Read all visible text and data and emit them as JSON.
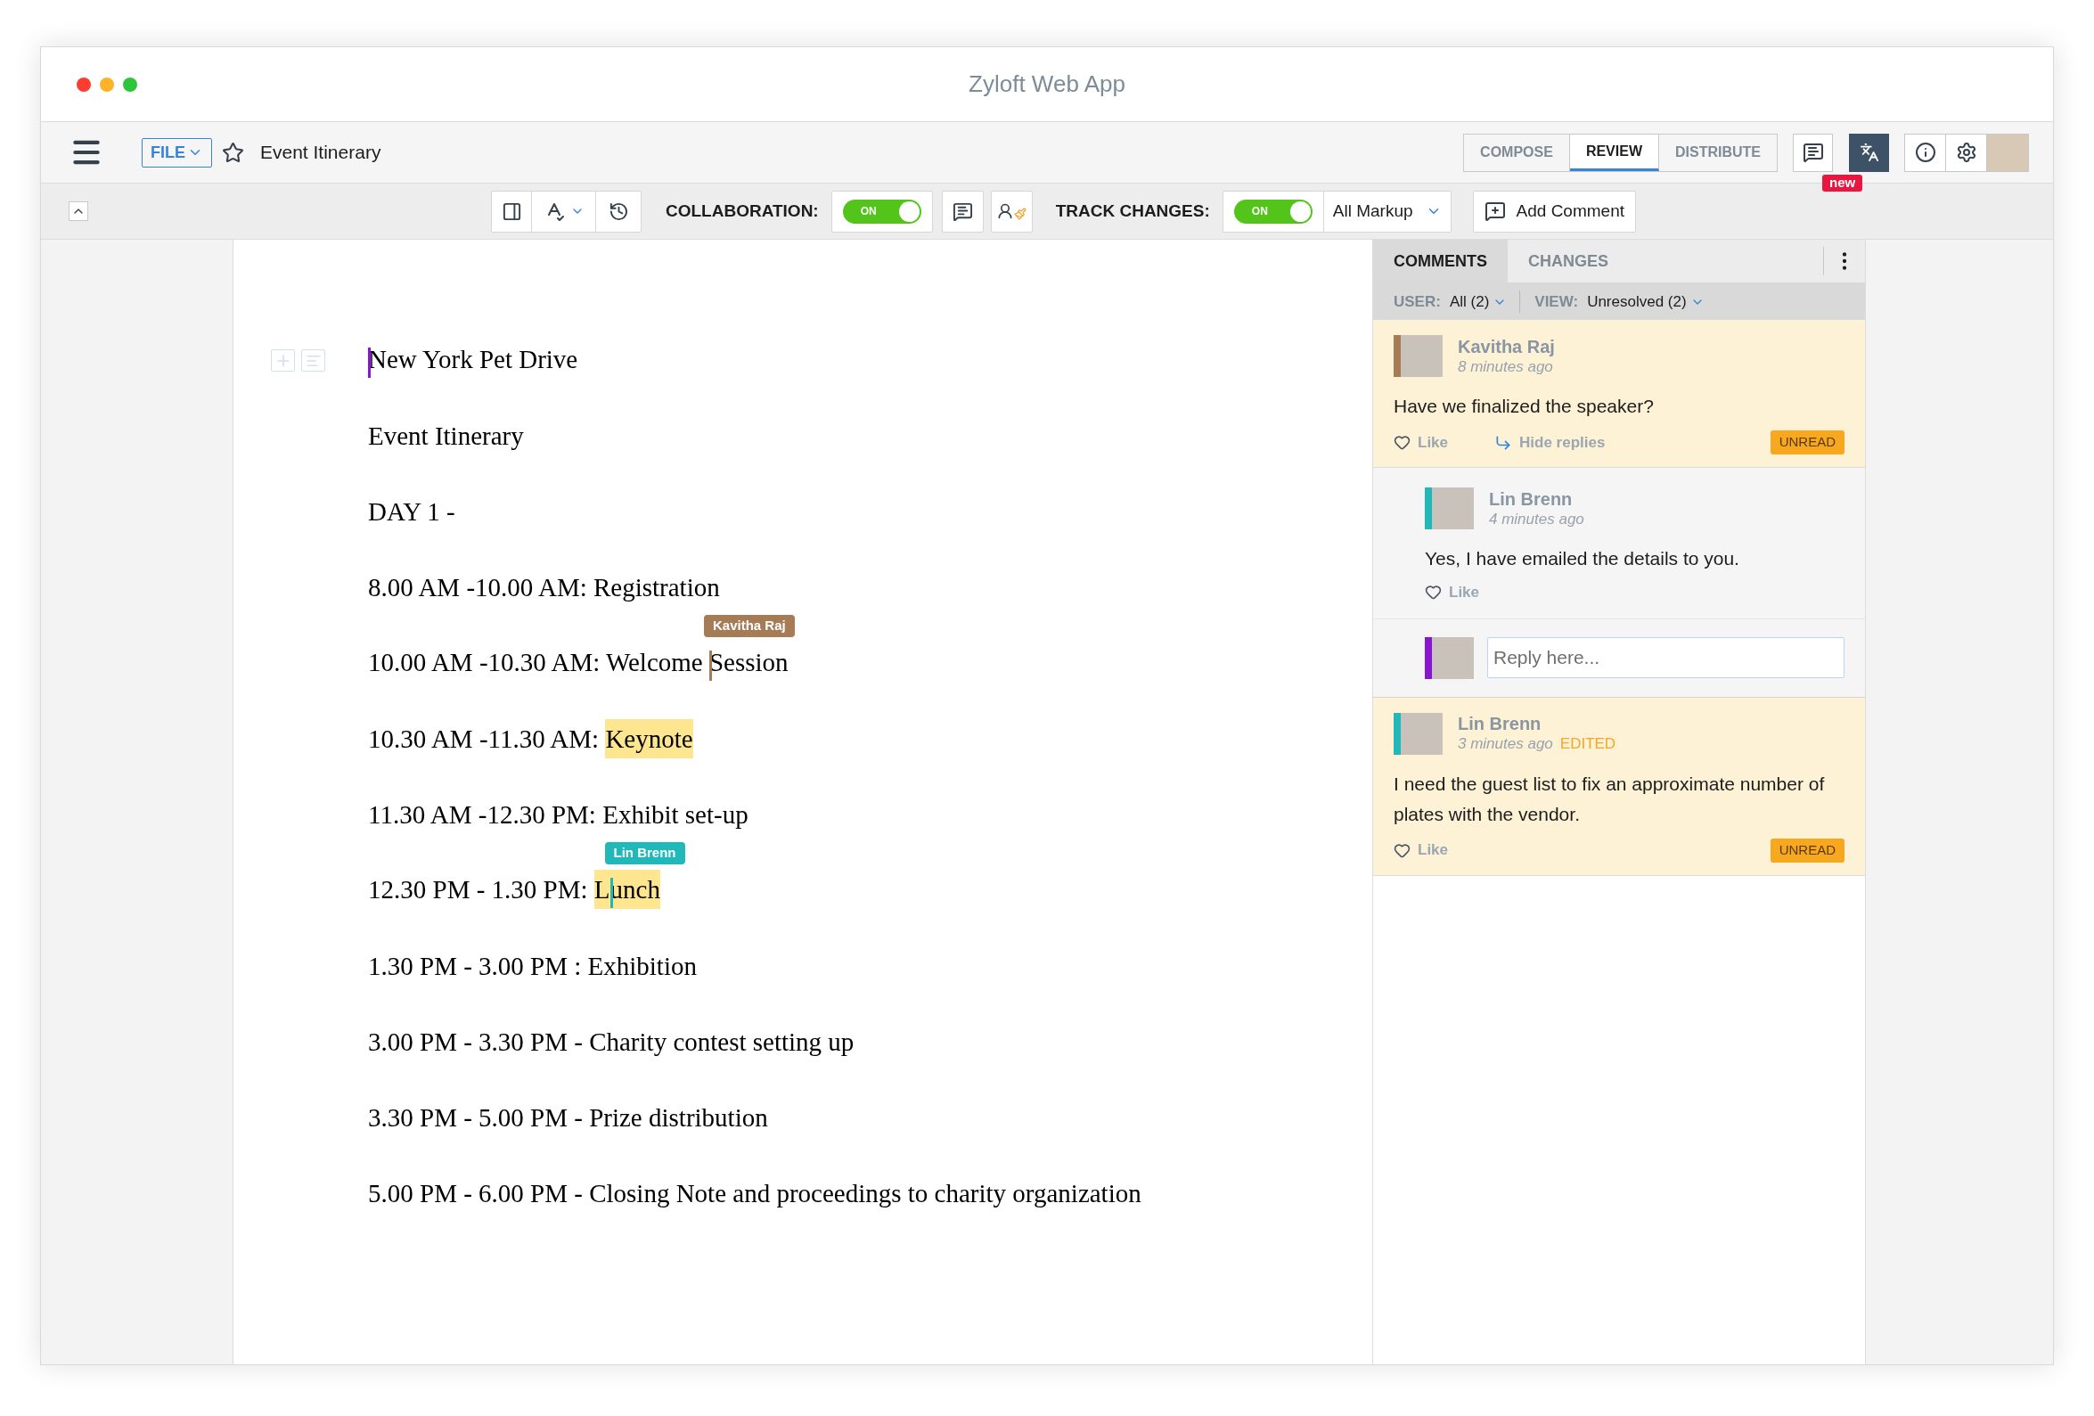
{
  "window": {
    "title": "Zyloft Web App"
  },
  "header": {
    "file_menu": "FILE",
    "starred": false,
    "document_title": "Event Itinerary",
    "tabs": [
      {
        "label": "COMPOSE",
        "selected": false
      },
      {
        "label": "REVIEW",
        "selected": true
      },
      {
        "label": "DISTRIBUTE",
        "selected": false
      }
    ],
    "new_badge": "new"
  },
  "toolbar": {
    "collaboration": {
      "label": "COLLABORATION:",
      "toggle": {
        "on": true,
        "text": "ON"
      }
    },
    "track_changes": {
      "label": "TRACK CHANGES:",
      "toggle": {
        "on": true,
        "text": "ON"
      },
      "markup": "All Markup"
    },
    "add_comment": "Add Comment"
  },
  "document": {
    "lines": [
      {
        "parts": [
          {
            "kind": "cursor",
            "color": "#8a14d4"
          },
          {
            "kind": "text",
            "text": "New York Pet Drive",
            "highlighted": false
          }
        ]
      },
      {
        "parts": [
          {
            "kind": "text",
            "text": "Event Itinerary",
            "highlighted": false
          }
        ]
      },
      {
        "parts": [
          {
            "kind": "text",
            "text": "DAY 1 -",
            "highlighted": false
          }
        ]
      },
      {
        "parts": [
          {
            "kind": "text",
            "text": "8.00 AM -10.00 AM: Registration",
            "highlighted": false
          }
        ]
      },
      {
        "parts": [
          {
            "kind": "text",
            "text": "10.00 AM -10.30 AM: Welcome ",
            "highlighted": false
          },
          {
            "kind": "cursor",
            "color": "#a57c55",
            "label": "Kavitha Raj"
          },
          {
            "kind": "text",
            "text": "Session",
            "highlighted": false
          }
        ]
      },
      {
        "parts": [
          {
            "kind": "text",
            "text": "10.30 AM -11.30 AM: ",
            "highlighted": false
          },
          {
            "kind": "text",
            "text": "Keynote",
            "highlighted": true
          }
        ]
      },
      {
        "parts": [
          {
            "kind": "text",
            "text": "11.30 AM -12.30 PM: Exhibit set-up",
            "highlighted": false
          }
        ]
      },
      {
        "parts": [
          {
            "kind": "text",
            "text": "12.30 PM - 1.30 PM: ",
            "highlighted": false
          },
          {
            "kind": "text",
            "text": "L",
            "highlighted": true
          },
          {
            "kind": "cursor",
            "color": "#20b8b8",
            "label": "Lin Brenn"
          },
          {
            "kind": "text",
            "text": "unch",
            "highlighted": true
          }
        ]
      },
      {
        "parts": [
          {
            "kind": "text",
            "text": "1.30 PM - 3.00 PM : Exhibition",
            "highlighted": false
          }
        ]
      },
      {
        "parts": [
          {
            "kind": "text",
            "text": "3.00 PM - 3.30 PM - Charity contest setting up",
            "highlighted": false
          }
        ]
      },
      {
        "parts": [
          {
            "kind": "text",
            "text": "3.30 PM - 5.00 PM - Prize distribution",
            "highlighted": false
          }
        ]
      },
      {
        "parts": [
          {
            "kind": "text",
            "text": "5.00 PM - 6.00 PM - Closing Note and proceedings to charity organization",
            "highlighted": false
          }
        ]
      }
    ]
  },
  "comments_panel": {
    "tabs": [
      {
        "label": "COMMENTS",
        "selected": true
      },
      {
        "label": "CHANGES",
        "selected": false
      }
    ],
    "filters": [
      {
        "label": "USER:",
        "value": "All (2)"
      },
      {
        "label": "VIEW:",
        "value": "Unresolved (2)"
      }
    ],
    "threads": [
      {
        "author": "Kavitha Raj",
        "color": "#a57c55",
        "time": "8 minutes ago",
        "text": "Have we finalized the speaker?",
        "like": "Like",
        "hide_replies": "Hide replies",
        "unread": true,
        "badge": "UNREAD",
        "replies": [
          {
            "author": "Lin Brenn",
            "color": "#20b8b8",
            "time": "4 minutes ago",
            "text": "Yes, I have emailed the details to you.",
            "like": "Like"
          }
        ],
        "reply_box": {
          "placeholder": "Reply here...",
          "color": "#8a14d4"
        }
      },
      {
        "author": "Lin Brenn",
        "color": "#20b8b8",
        "time": "3 minutes ago",
        "edited": "EDITED",
        "text": "I need the guest list to fix an approximate number of plates with the vendor.",
        "like": "Like",
        "unread": true,
        "badge": "UNREAD"
      }
    ]
  }
}
